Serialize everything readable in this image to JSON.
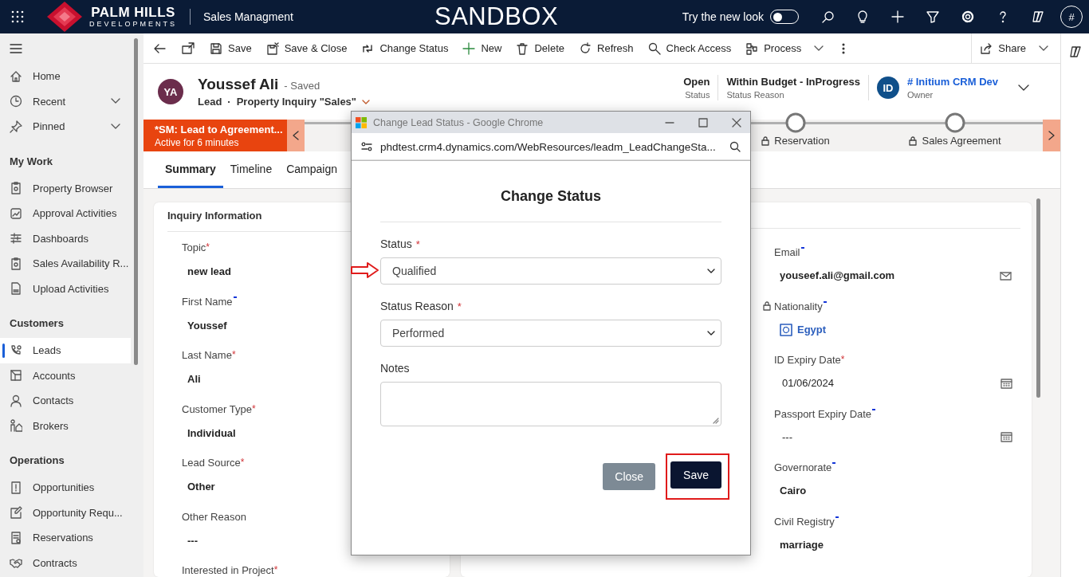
{
  "top_bar": {
    "brand": "PALM HILLS",
    "brand_sub": "DEVELOPMENTS",
    "app_name": "Sales Managment",
    "environment": "SANDBOX",
    "new_look": {
      "label": "Try the new look",
      "on": false
    },
    "user_initial": "#"
  },
  "sidebar": {
    "top_items": [
      {
        "label": "Home",
        "selected": false,
        "expandable": false
      },
      {
        "label": "Recent",
        "selected": false,
        "expandable": true
      },
      {
        "label": "Pinned",
        "selected": false,
        "expandable": true
      }
    ],
    "groups": [
      {
        "title": "My Work",
        "items": [
          {
            "label": "Property Browser",
            "selected": false
          },
          {
            "label": "Approval Activities",
            "selected": false
          },
          {
            "label": "Dashboards",
            "selected": false
          },
          {
            "label": "Sales Availability R...",
            "selected": false
          },
          {
            "label": "Upload Activities",
            "selected": false
          }
        ]
      },
      {
        "title": "Customers",
        "items": [
          {
            "label": "Leads",
            "selected": true
          },
          {
            "label": "Accounts",
            "selected": false
          },
          {
            "label": "Contacts",
            "selected": false
          },
          {
            "label": "Brokers",
            "selected": false
          }
        ]
      },
      {
        "title": "Operations",
        "items": [
          {
            "label": "Opportunities",
            "selected": false
          },
          {
            "label": "Opportunity Requ...",
            "selected": false
          },
          {
            "label": "Reservations",
            "selected": false
          },
          {
            "label": "Contracts",
            "selected": false
          }
        ]
      }
    ]
  },
  "command_bar": {
    "buttons": [
      {
        "label": "Save",
        "dropdown": false
      },
      {
        "label": "Save & Close",
        "dropdown": false
      },
      {
        "label": "Change Status",
        "dropdown": false
      },
      {
        "label": "New",
        "dropdown": false
      },
      {
        "label": "Delete",
        "dropdown": false
      },
      {
        "label": "Refresh",
        "dropdown": false
      },
      {
        "label": "Check Access",
        "dropdown": false
      },
      {
        "label": "Process",
        "dropdown": true
      }
    ],
    "share": {
      "label": "Share",
      "dropdown": true
    }
  },
  "header": {
    "initials": "YA",
    "title": "Youssef Ali",
    "save_state": "- Saved",
    "entity": "Lead",
    "separator": "·",
    "form_name": "Property Inquiry \"Sales\"",
    "fields": [
      {
        "value": "Open",
        "label": "Status"
      },
      {
        "value": "Within Budget - InProgress",
        "label": "Status Reason"
      }
    ],
    "owner": {
      "initials": "ID",
      "name": "# Initium CRM Dev",
      "label": "Owner"
    }
  },
  "process_bar": {
    "name": "*SM: Lead to Agreement...",
    "duration": "Active for 6 minutes",
    "stages": [
      {
        "label": "Reservation",
        "locked": true
      },
      {
        "label": "Sales Agreement",
        "locked": true
      }
    ]
  },
  "tabs": [
    {
      "label": "Summary",
      "selected": true
    },
    {
      "label": "Timeline",
      "selected": false
    },
    {
      "label": "Campaign",
      "selected": false
    }
  ],
  "left_section": {
    "title": "Inquiry Information",
    "fields": [
      {
        "label": "Topic",
        "recommended": false,
        "mark": "*",
        "value": "new lead"
      },
      {
        "label": "First Name",
        "recommended": true,
        "value": "Youssef"
      },
      {
        "label": "Last Name",
        "recommended": false,
        "mark": "*",
        "value": "Ali"
      },
      {
        "label": "Customer Type",
        "recommended": false,
        "mark": "*",
        "value": "Individual"
      },
      {
        "label": "Lead Source",
        "recommended": false,
        "mark": "*",
        "value": "Other"
      },
      {
        "label": "Other Reason",
        "recommended": false,
        "value": "---"
      },
      {
        "label": "Interested in Project",
        "recommended": false,
        "mark": "*"
      }
    ]
  },
  "right_section": {
    "fields": [
      {
        "label": "Email",
        "recommended": true,
        "value": "youseef.ali@gmail.com",
        "kind": "email"
      },
      {
        "label": "Nationality",
        "recommended": true,
        "value": "Egypt",
        "kind": "lookup",
        "locked": true
      },
      {
        "label": "ID Expiry Date",
        "recommended": false,
        "mark": "*",
        "value": "01/06/2024",
        "kind": "date"
      },
      {
        "label": "Passport Expiry Date",
        "recommended": true,
        "value": "---",
        "kind": "date"
      },
      {
        "label": "Governorate",
        "recommended": true,
        "value": "Cairo",
        "kind": "text"
      },
      {
        "label": "Civil Registry",
        "recommended": true,
        "value": "marriage",
        "kind": "text"
      }
    ]
  },
  "popup": {
    "window_title": "Change Lead Status - Google Chrome",
    "url": "phdtest.crm4.dynamics.com/WebResources/leadm_LeadChangeSta...",
    "heading": "Change Status",
    "fields": [
      {
        "label": "Status",
        "mark": "*",
        "kind": "select",
        "value": "Qualified",
        "highlighted": true
      },
      {
        "label": "Status Reason",
        "mark": "*",
        "kind": "select",
        "value": "Performed",
        "highlighted": false
      },
      {
        "label": "Notes",
        "kind": "textarea"
      }
    ],
    "buttons": [
      {
        "label": "Close",
        "kind": "secondary",
        "highlighted": false
      },
      {
        "label": "Save",
        "kind": "primary",
        "highlighted": true
      }
    ]
  }
}
